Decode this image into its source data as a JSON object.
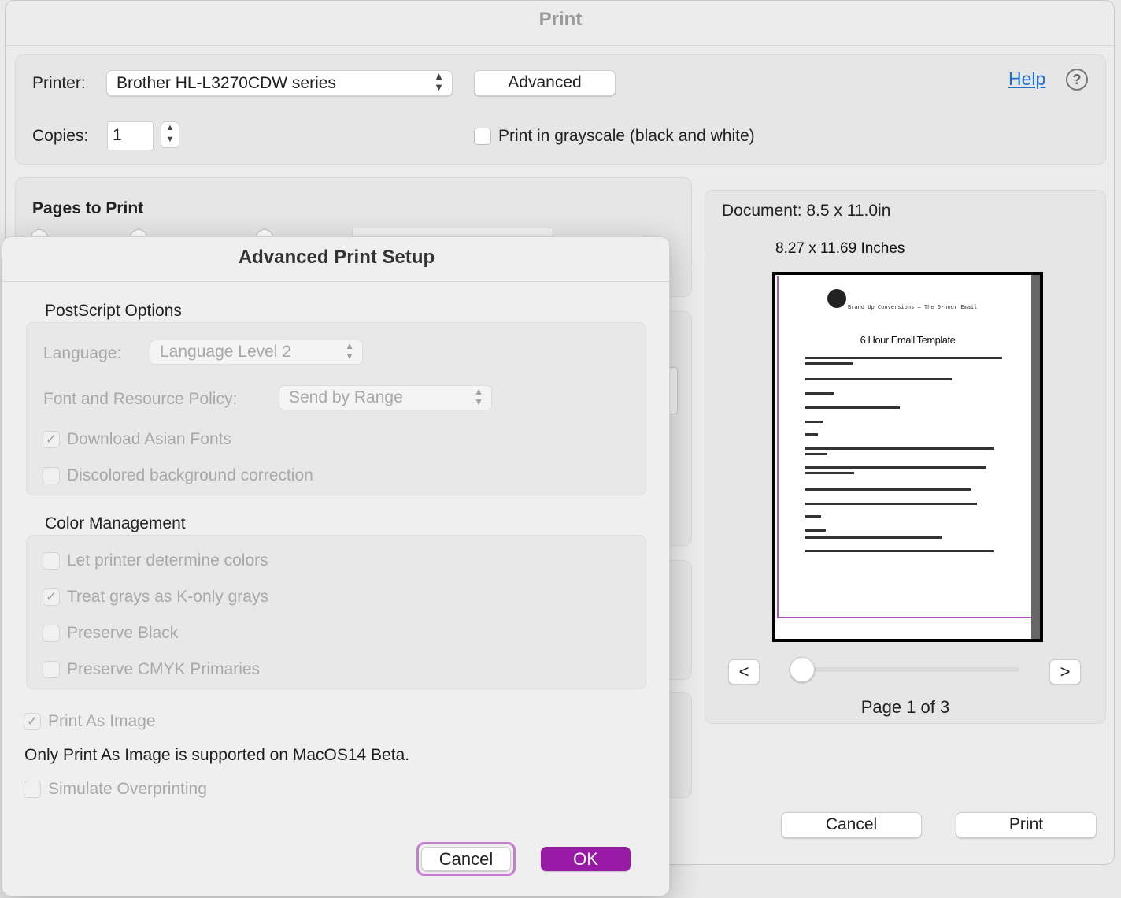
{
  "print_window": {
    "title": "Print",
    "printer_label": "Printer:",
    "printer_value": "Brother HL-L3270CDW series",
    "advanced_button": "Advanced",
    "help_link": "Help",
    "help_icon": "question-mark-circle-icon",
    "copies_label": "Copies:",
    "copies_value": "1",
    "grayscale_label": "Print in grayscale (black and white)",
    "grayscale_checked": false,
    "pages_to_print_heading": "Pages to Print",
    "cancel_button": "Cancel",
    "print_button": "Print"
  },
  "preview": {
    "document_size": "Document: 8.5 x 11.0in",
    "paper_size": "8.27 x 11.69 Inches",
    "sheet_title": "6 Hour Email Template",
    "sheet_header": "Brand Up Conversions – The 6-hour Email",
    "prev_button": "<",
    "next_button": ">",
    "page_indicator": "Page 1 of 3",
    "page_slider_value": 1,
    "page_slider_max": 3
  },
  "advanced_dialog": {
    "title": "Advanced Print Setup",
    "postscript_heading": "PostScript Options",
    "language_label": "Language:",
    "language_value": "Language Level 2",
    "font_policy_label": "Font and Resource Policy:",
    "font_policy_value": "Send by Range",
    "download_asian_fonts": "Download Asian Fonts",
    "download_asian_fonts_checked": true,
    "discolored_bg": "Discolored background correction",
    "discolored_bg_checked": false,
    "color_heading": "Color Management",
    "let_printer_colors": "Let printer determine colors",
    "let_printer_colors_checked": false,
    "treat_grays": "Treat grays as K-only grays",
    "treat_grays_checked": true,
    "preserve_black": "Preserve Black",
    "preserve_black_checked": false,
    "preserve_cmyk": "Preserve CMYK Primaries",
    "preserve_cmyk_checked": false,
    "print_as_image": "Print As Image",
    "print_as_image_checked": true,
    "macos_note": "Only Print As Image is supported on MacOS14 Beta.",
    "simulate_overprinting": "Simulate Overprinting",
    "simulate_overprinting_checked": false,
    "cancel_button": "Cancel",
    "ok_button": "OK"
  },
  "colors": {
    "accent": "#9a1aa8",
    "link": "#1f6fd1",
    "preview_border": "#b04fc2"
  }
}
